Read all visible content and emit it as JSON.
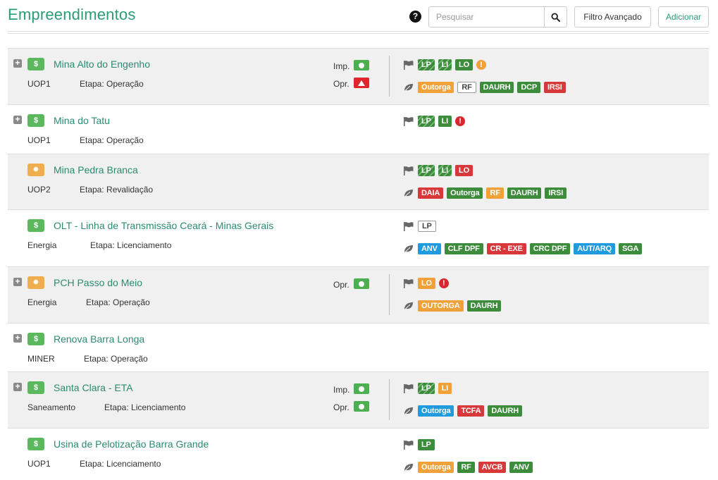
{
  "header": {
    "title": "Empreendimentos",
    "help_icon": "question-circle-icon",
    "help_symbol": "?",
    "search_placeholder": "Pesquisar",
    "search_icon": "magnifier-icon",
    "filter_label": "Filtro Avançado",
    "add_label": "Adicionar"
  },
  "colors": {
    "brand": "#2a9d78",
    "tag_green": "#3c8c3c",
    "tag_orange": "#f0a13a",
    "tag_red": "#d9383a",
    "tag_blue": "#1f9bde"
  },
  "rows": [
    {
      "name": "Mina Alto do Engenho",
      "unit": "UOP1",
      "stage": "Etapa: Operação",
      "type": "dollar",
      "expand": "+",
      "type_symbol": "$",
      "imp_label": "Imp.",
      "opr_label": "Opr.",
      "imp": "ok",
      "opr": "warn",
      "licencas": [
        {
          "t": "LP",
          "s": "striped"
        },
        {
          "t": "LI",
          "s": "striped"
        },
        {
          "t": "LO",
          "s": "green"
        }
      ],
      "lic_alert": "orange",
      "alert_symbol": "!",
      "outorgas": [
        {
          "t": "Outorga",
          "s": "orange"
        },
        {
          "t": "RF",
          "s": "outline"
        },
        {
          "t": "DAURH",
          "s": "green"
        },
        {
          "t": "DCP",
          "s": "green"
        },
        {
          "t": "IRSI",
          "s": "red"
        }
      ]
    },
    {
      "name": "Mina do Tatu",
      "unit": "UOP1",
      "stage": "Etapa: Operação",
      "type": "dollar",
      "expand": "+",
      "type_symbol": "$",
      "licencas": [
        {
          "t": "LP",
          "s": "striped"
        },
        {
          "t": "LI",
          "s": "green"
        }
      ],
      "lic_alert": "red",
      "alert_symbol": "!",
      "outorgas": []
    },
    {
      "name": "Mina Pedra Branca",
      "unit": "UOP2",
      "stage": "Etapa: Revalidação",
      "type": "gear",
      "type_symbol": "✹",
      "licencas": [
        {
          "t": "LP",
          "s": "striped"
        },
        {
          "t": "LI",
          "s": "striped"
        },
        {
          "t": "LO",
          "s": "red"
        }
      ],
      "outorgas": [
        {
          "t": "DAIA",
          "s": "red"
        },
        {
          "t": "Outorga",
          "s": "green"
        },
        {
          "t": "RF",
          "s": "orange"
        },
        {
          "t": "DAURH",
          "s": "green"
        },
        {
          "t": "IRSI",
          "s": "green"
        }
      ]
    },
    {
      "name": "OLT - Linha de Transmissão Ceará - Minas Gerais",
      "unit": "Energia",
      "stage": "Etapa: Licenciamento",
      "type": "dollar",
      "type_symbol": "$",
      "licencas": [
        {
          "t": "LP",
          "s": "outline"
        }
      ],
      "outorgas": [
        {
          "t": "ANV",
          "s": "blue"
        },
        {
          "t": "CLF DPF",
          "s": "green"
        },
        {
          "t": "CR - EXE",
          "s": "red"
        },
        {
          "t": "CRC DPF",
          "s": "green"
        },
        {
          "t": "AUT/ARQ",
          "s": "blue"
        },
        {
          "t": "SGA",
          "s": "green"
        }
      ]
    },
    {
      "name": "PCH Passo do Meio",
      "unit": "Energia",
      "stage": "Etapa: Operação",
      "type": "gear",
      "expand": "+",
      "type_symbol": "✹",
      "opr_label": "Opr.",
      "opr": "ok",
      "licencas": [
        {
          "t": "LO",
          "s": "orange"
        }
      ],
      "lic_alert": "red",
      "alert_symbol": "!",
      "outorgas": [
        {
          "t": "OUTORGA",
          "s": "orange"
        },
        {
          "t": "DAURH",
          "s": "green"
        }
      ]
    },
    {
      "name": "Renova Barra Longa",
      "unit": "MINER",
      "stage": "Etapa: Operação",
      "type": "dollar",
      "expand": "+",
      "type_symbol": "$",
      "licencas": [],
      "outorgas": []
    },
    {
      "name": "Santa Clara - ETA",
      "unit": "Saneamento",
      "stage": "Etapa: Licenciamento",
      "type": "dollar",
      "expand": "+",
      "type_symbol": "$",
      "imp_label": "Imp.",
      "opr_label": "Opr.",
      "imp": "ok",
      "opr": "ok",
      "licencas": [
        {
          "t": "LP",
          "s": "striped"
        },
        {
          "t": "LI",
          "s": "orange"
        }
      ],
      "outorgas": [
        {
          "t": "Outorga",
          "s": "blue"
        },
        {
          "t": "TCFA",
          "s": "red"
        },
        {
          "t": "DAURH",
          "s": "green"
        }
      ]
    },
    {
      "name": "Usina de Pelotização Barra Grande",
      "unit": "UOP1",
      "stage": "Etapa: Licenciamento",
      "type": "dollar",
      "type_symbol": "$",
      "licencas": [
        {
          "t": "LP",
          "s": "green"
        }
      ],
      "outorgas": [
        {
          "t": "Outorga",
          "s": "orange"
        },
        {
          "t": "RF",
          "s": "green"
        },
        {
          "t": "AVCB",
          "s": "red"
        },
        {
          "t": "ANV",
          "s": "green"
        }
      ]
    }
  ]
}
